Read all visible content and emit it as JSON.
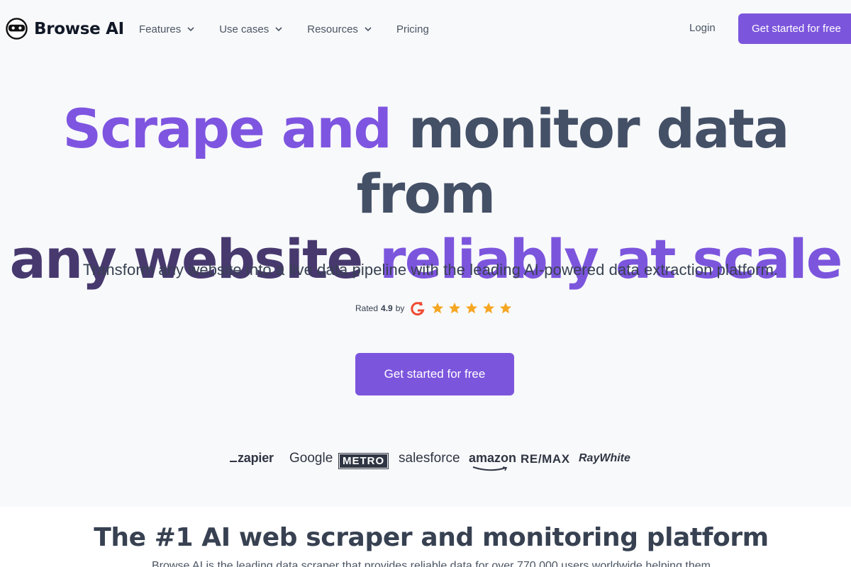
{
  "brand": {
    "name": "Browse AI",
    "accent": "#7c55dd"
  },
  "nav": {
    "items": [
      {
        "label": "Features",
        "has_dropdown": true
      },
      {
        "label": "Use cases",
        "has_dropdown": true
      },
      {
        "label": "Resources",
        "has_dropdown": true
      },
      {
        "label": "Pricing",
        "has_dropdown": false
      }
    ],
    "login": "Login",
    "cta": "Get started for free"
  },
  "hero": {
    "title_parts": [
      "Scrape",
      " and ",
      "monitor data from",
      "any website ",
      "reliably at scale"
    ],
    "subtitle": "Transform any website into a live data pipeline with the leading AI-powered data extraction platform.",
    "rating": {
      "prefix": "Rated",
      "value": "4.9",
      "suffix": "by",
      "stars": 5,
      "star_color": "#f5a623",
      "provider_icon": "g2-icon"
    },
    "cta": "Get started for free"
  },
  "logos": [
    "zapier",
    "Google",
    "METRO",
    "salesforce",
    "amazon",
    "RE/MAX",
    "RayWhite"
  ],
  "section2": {
    "title": "The #1 AI web scraper and monitoring platform",
    "text": "Browse AI is the leading data scraper that provides reliable data for over 770,000 users worldwide helping them"
  }
}
